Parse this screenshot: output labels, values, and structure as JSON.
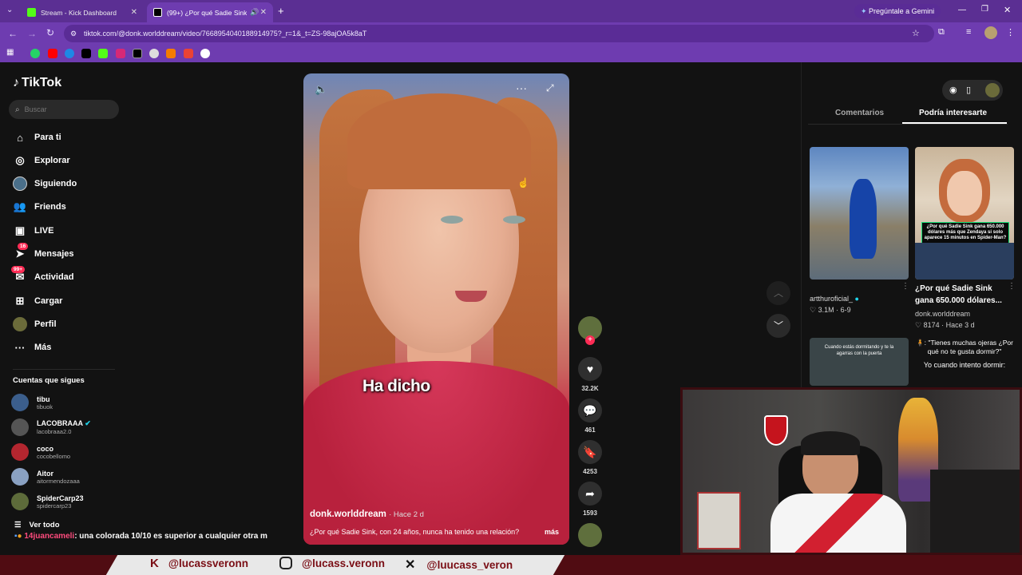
{
  "browser": {
    "tabs": [
      {
        "label": "Stream - Kick Dashboard",
        "active": false
      },
      {
        "label": "(99+) ¿Por qué Sadie Sink, c",
        "active": true
      }
    ],
    "new_tab": "+",
    "gemini_label": "Pregúntale a Gemini",
    "url": "tiktok.com/@donk.worlddream/video/7668954040188914975?_r=1&_t=ZS-98ajOA5k8aT"
  },
  "tiktok": {
    "logo": "TikTok",
    "search_placeholder": "Buscar",
    "nav": [
      {
        "label": "Para ti",
        "icon": "home-icon"
      },
      {
        "label": "Explorar",
        "icon": "compass-icon"
      },
      {
        "label": "Siguiendo",
        "icon": "following-icon"
      },
      {
        "label": "Friends",
        "icon": "friends-icon"
      },
      {
        "label": "LIVE",
        "icon": "live-icon"
      },
      {
        "label": "Mensajes",
        "icon": "messages-icon",
        "badge": "16"
      },
      {
        "label": "Actividad",
        "icon": "activity-icon",
        "badge": "99+"
      },
      {
        "label": "Cargar",
        "icon": "upload-icon"
      },
      {
        "label": "Perfil",
        "icon": "profile-icon"
      },
      {
        "label": "Más",
        "icon": "more-icon"
      }
    ],
    "following_title": "Cuentas que sigues",
    "following": [
      {
        "name": "tibu",
        "handle": "tibuok",
        "color": "#3b5e8c"
      },
      {
        "name": "LACOBRAAA",
        "handle": "lacobraaa2.0",
        "color": "#555",
        "verified": true
      },
      {
        "name": "coco",
        "handle": "cocobellomo",
        "color": "#b3262f"
      },
      {
        "name": "Aitor",
        "handle": "aitormendozaaa",
        "color": "#8aa1c2"
      },
      {
        "name": "SpiderCarp23",
        "handle": "spidercarp23",
        "color": "#5d6b3a"
      }
    ],
    "see_all": "Ver todo",
    "video": {
      "caption_word": "Ha dicho",
      "author": "donk.worlddream",
      "time": "Hace 2 d",
      "description": "¿Por qué Sadie Sink, con 24 años, nunca ha tenido una relación?",
      "more": "más",
      "likes": "32.2K",
      "comments": "461",
      "saves": "4253",
      "shares": "1593"
    },
    "right_tabs": {
      "comments": "Comentarios",
      "suggested": "Podría interesarte"
    },
    "suggested": [
      {
        "title": "",
        "author": "artthuroficial_",
        "stats": "3.1M · 6-9"
      },
      {
        "title": "¿Por qué Sadie Sink gana 650.000 dólares...",
        "author": "donk.worlddream",
        "stats": "8174 · Hace 3 d",
        "overlay": "¿Por qué Sadie Sink gana 650.000 dólares más que Zendaya si solo aparece 15 minutos en Spider-Man?"
      },
      {
        "overlay": "Cuando estás dormitando y te la agarras con la puerta"
      },
      {
        "overlay": "🧍: \"Tienes muchas ojeras ¿Por qué no te gusta dormir?\"",
        "overlay2": "Yo cuando intento dormir:"
      }
    ]
  },
  "stream": {
    "chat_user": "14juancameli",
    "chat_text": ": una colorada 10/10 es superior a cualquier otra m",
    "socials": [
      {
        "icon": "kick-icon",
        "handle": "@lucassveronn"
      },
      {
        "icon": "instagram-icon",
        "handle": "@lucass.veronn"
      },
      {
        "icon": "x-icon",
        "handle": "@luucass_veron"
      }
    ]
  }
}
